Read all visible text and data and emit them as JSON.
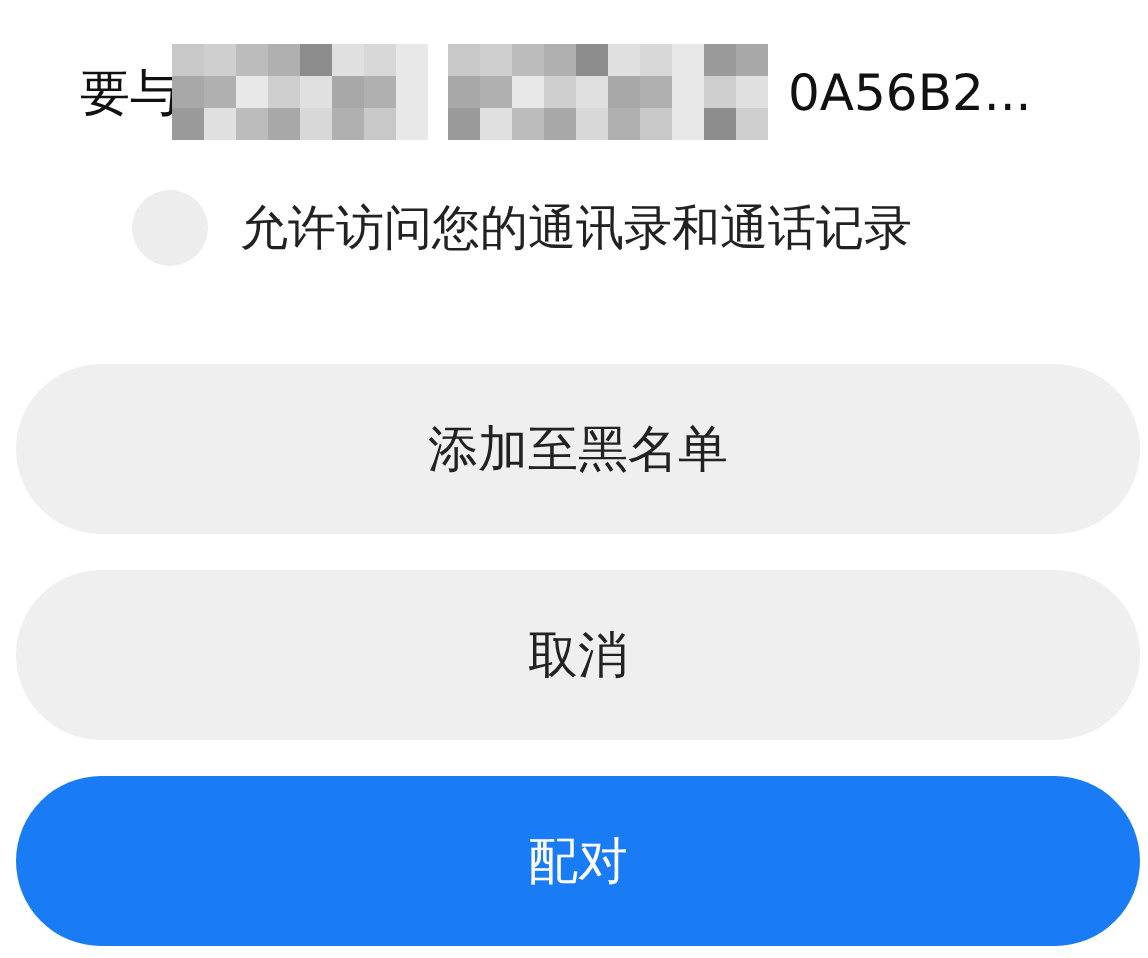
{
  "title": {
    "prefix": "要与",
    "suffix": "0A56B2..."
  },
  "permission": {
    "label": "允许访问您的通讯录和通话记录",
    "checked": false
  },
  "buttons": [
    {
      "label": "添加至黑名单",
      "kind": "secondary"
    },
    {
      "label": "取消",
      "kind": "secondary"
    },
    {
      "label": "配对",
      "kind": "primary"
    }
  ]
}
